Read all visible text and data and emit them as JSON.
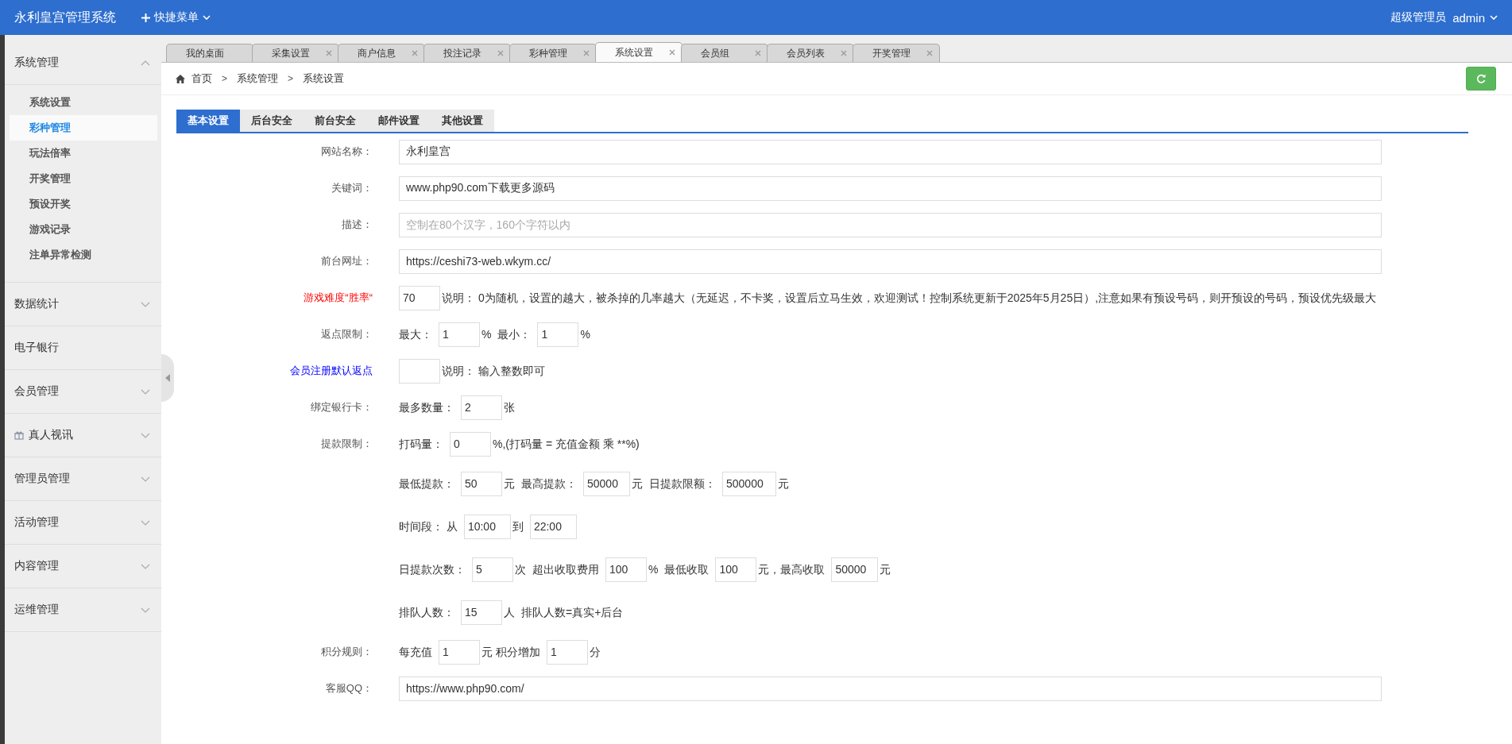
{
  "header": {
    "title": "永利皇宫管理系统",
    "quick_menu": "快捷菜单",
    "role": "超级管理员",
    "user": "admin"
  },
  "sidebar": [
    {
      "label": "系统管理",
      "kind": "group",
      "expanded": true,
      "children": [
        {
          "label": "系统设置",
          "selected": false
        },
        {
          "label": "彩种管理",
          "selected": true
        },
        {
          "label": "玩法倍率",
          "selected": false
        },
        {
          "label": "开奖管理",
          "selected": false
        },
        {
          "label": "预设开奖",
          "selected": false
        },
        {
          "label": "游戏记录",
          "selected": false
        },
        {
          "label": "注单异常检测",
          "selected": false
        }
      ]
    },
    {
      "label": "数据统计",
      "kind": "group",
      "expanded": false
    },
    {
      "label": "电子银行",
      "kind": "link",
      "expanded": false
    },
    {
      "label": "会员管理",
      "kind": "group",
      "expanded": false
    },
    {
      "label": "真人视讯",
      "kind": "gift-group",
      "expanded": false
    },
    {
      "label": "管理员管理",
      "kind": "group",
      "expanded": false
    },
    {
      "label": "活动管理",
      "kind": "group",
      "expanded": false
    },
    {
      "label": "内容管理",
      "kind": "group",
      "expanded": false
    },
    {
      "label": "运维管理",
      "kind": "group",
      "expanded": false
    }
  ],
  "tabs": [
    {
      "label": "我的桌面",
      "closable": false,
      "selected": false
    },
    {
      "label": "采集设置",
      "closable": true,
      "selected": false
    },
    {
      "label": "商户信息",
      "closable": true,
      "selected": false
    },
    {
      "label": "投注记录",
      "closable": true,
      "selected": false
    },
    {
      "label": "彩种管理",
      "closable": true,
      "selected": false
    },
    {
      "label": "系统设置",
      "closable": true,
      "selected": true
    },
    {
      "label": "会员组",
      "closable": true,
      "selected": false
    },
    {
      "label": "会员列表",
      "closable": true,
      "selected": false
    },
    {
      "label": "开奖管理",
      "closable": true,
      "selected": false
    }
  ],
  "breadcrumb": [
    {
      "kind": "link",
      "text": "首页"
    },
    {
      "kind": "separator",
      "text": ">"
    },
    {
      "kind": "link",
      "text": "系统管理"
    },
    {
      "kind": "separator",
      "text": ">"
    },
    {
      "kind": "link",
      "text": "系统设置"
    }
  ],
  "form_tabs": [
    {
      "label": "基本设置",
      "selected": true
    },
    {
      "label": "后台安全",
      "selected": false
    },
    {
      "label": "前台安全",
      "selected": false
    },
    {
      "label": "邮件设置",
      "selected": false
    },
    {
      "label": "其他设置",
      "selected": false
    }
  ],
  "rows": [
    {
      "label": "网站名称：",
      "kind": "field",
      "value": "永利皇宫"
    },
    {
      "label": "关键词：",
      "kind": "field",
      "value": "www.php90.com下载更多源码"
    },
    {
      "label": "描述：",
      "kind": "field",
      "placeholder": "空制在80个汉字，160个字符以内"
    },
    {
      "label": "前台网址：",
      "kind": "field",
      "value": "https://ceshi73-web.wkym.cc/"
    },
    {
      "label": "游戏难度“胜率“",
      "color": "#ff0000",
      "kind": "inline",
      "parts": [
        {
          "kind": "input",
          "value": "70"
        },
        {
          "kind": "text",
          "text": "说明： 0为随机，设置的越大，被杀掉的几率越大（无延迟，不卡奖，设置后立马生效，欢迎测试！控制系统更新于2025年5月25日）,注意如果有预设号码，则开预设的号码，预设优先级最大"
        }
      ]
    },
    {
      "label": "返点限制：",
      "kind": "inline",
      "parts": [
        {
          "kind": "text",
          "text": "最大："
        },
        {
          "kind": "input",
          "value": "1"
        },
        {
          "kind": "text",
          "text": "%"
        },
        {
          "kind": "text",
          "text": "最小："
        },
        {
          "kind": "input",
          "value": "1"
        },
        {
          "kind": "text",
          "text": "%"
        }
      ]
    },
    {
      "label": "会员注册默认返点",
      "color": "#0000ff",
      "kind": "inline",
      "parts": [
        {
          "kind": "input"
        },
        {
          "kind": "text",
          "text": "说明： 输入整数即可"
        }
      ]
    },
    {
      "label": "绑定银行卡：",
      "kind": "inline",
      "parts": [
        {
          "kind": "text",
          "text": "最多数量："
        },
        {
          "kind": "input",
          "value": "2"
        },
        {
          "kind": "text",
          "text": "张"
        }
      ]
    },
    {
      "label": "提款限制：",
      "kind": "inline",
      "parts": [
        {
          "kind": "text",
          "text": "打码量："
        },
        {
          "kind": "input",
          "value": "0"
        },
        {
          "kind": "text",
          "text": "%,(打码量 = 充值金额 乘 **%)"
        }
      ]
    },
    {
      "kind": "inline",
      "parts": [
        {
          "kind": "text",
          "text": "最低提款："
        },
        {
          "kind": "input",
          "value": "50"
        },
        {
          "kind": "text",
          "text": "元"
        },
        {
          "kind": "text",
          "text": "最高提款："
        },
        {
          "kind": "input",
          "value": "50000"
        },
        {
          "kind": "text",
          "text": "元"
        },
        {
          "kind": "text",
          "text": "日提款限额："
        },
        {
          "kind": "input",
          "value": "500000"
        },
        {
          "kind": "text",
          "text": "元"
        }
      ]
    },
    {
      "kind": "inline",
      "parts": [
        {
          "kind": "text",
          "text": "时间段：  从"
        },
        {
          "kind": "input",
          "value": "10:00"
        },
        {
          "kind": "text",
          "text": "到"
        },
        {
          "kind": "input",
          "value": "22:00"
        }
      ]
    },
    {
      "kind": "inline",
      "parts": [
        {
          "kind": "text",
          "text": "日提款次数："
        },
        {
          "kind": "input",
          "value": "5"
        },
        {
          "kind": "text",
          "text": "次"
        },
        {
          "kind": "text",
          "text": "超出收取费用"
        },
        {
          "kind": "input",
          "value": "100"
        },
        {
          "kind": "text",
          "text": "%"
        },
        {
          "kind": "text",
          "text": "最低收取"
        },
        {
          "kind": "input",
          "value": "100"
        },
        {
          "kind": "text",
          "text": "元，最高收取"
        },
        {
          "kind": "input",
          "value": "50000"
        },
        {
          "kind": "text",
          "text": "元"
        }
      ]
    },
    {
      "kind": "inline",
      "parts": [
        {
          "kind": "text",
          "text": "排队人数："
        },
        {
          "kind": "input",
          "value": "15"
        },
        {
          "kind": "text",
          "text": "人"
        },
        {
          "kind": "text",
          "text": "排队人数=真实+后台"
        }
      ]
    },
    {
      "label": "积分规则：",
      "kind": "inline",
      "parts": [
        {
          "kind": "text",
          "text": "每充值"
        },
        {
          "kind": "input",
          "value": "1"
        },
        {
          "kind": "text",
          "text": "元 积分增加"
        },
        {
          "kind": "input",
          "value": "1"
        },
        {
          "kind": "text",
          "text": "分"
        }
      ]
    },
    {
      "label": "客服QQ：",
      "kind": "field",
      "value": "https://www.php90.com/"
    }
  ]
}
